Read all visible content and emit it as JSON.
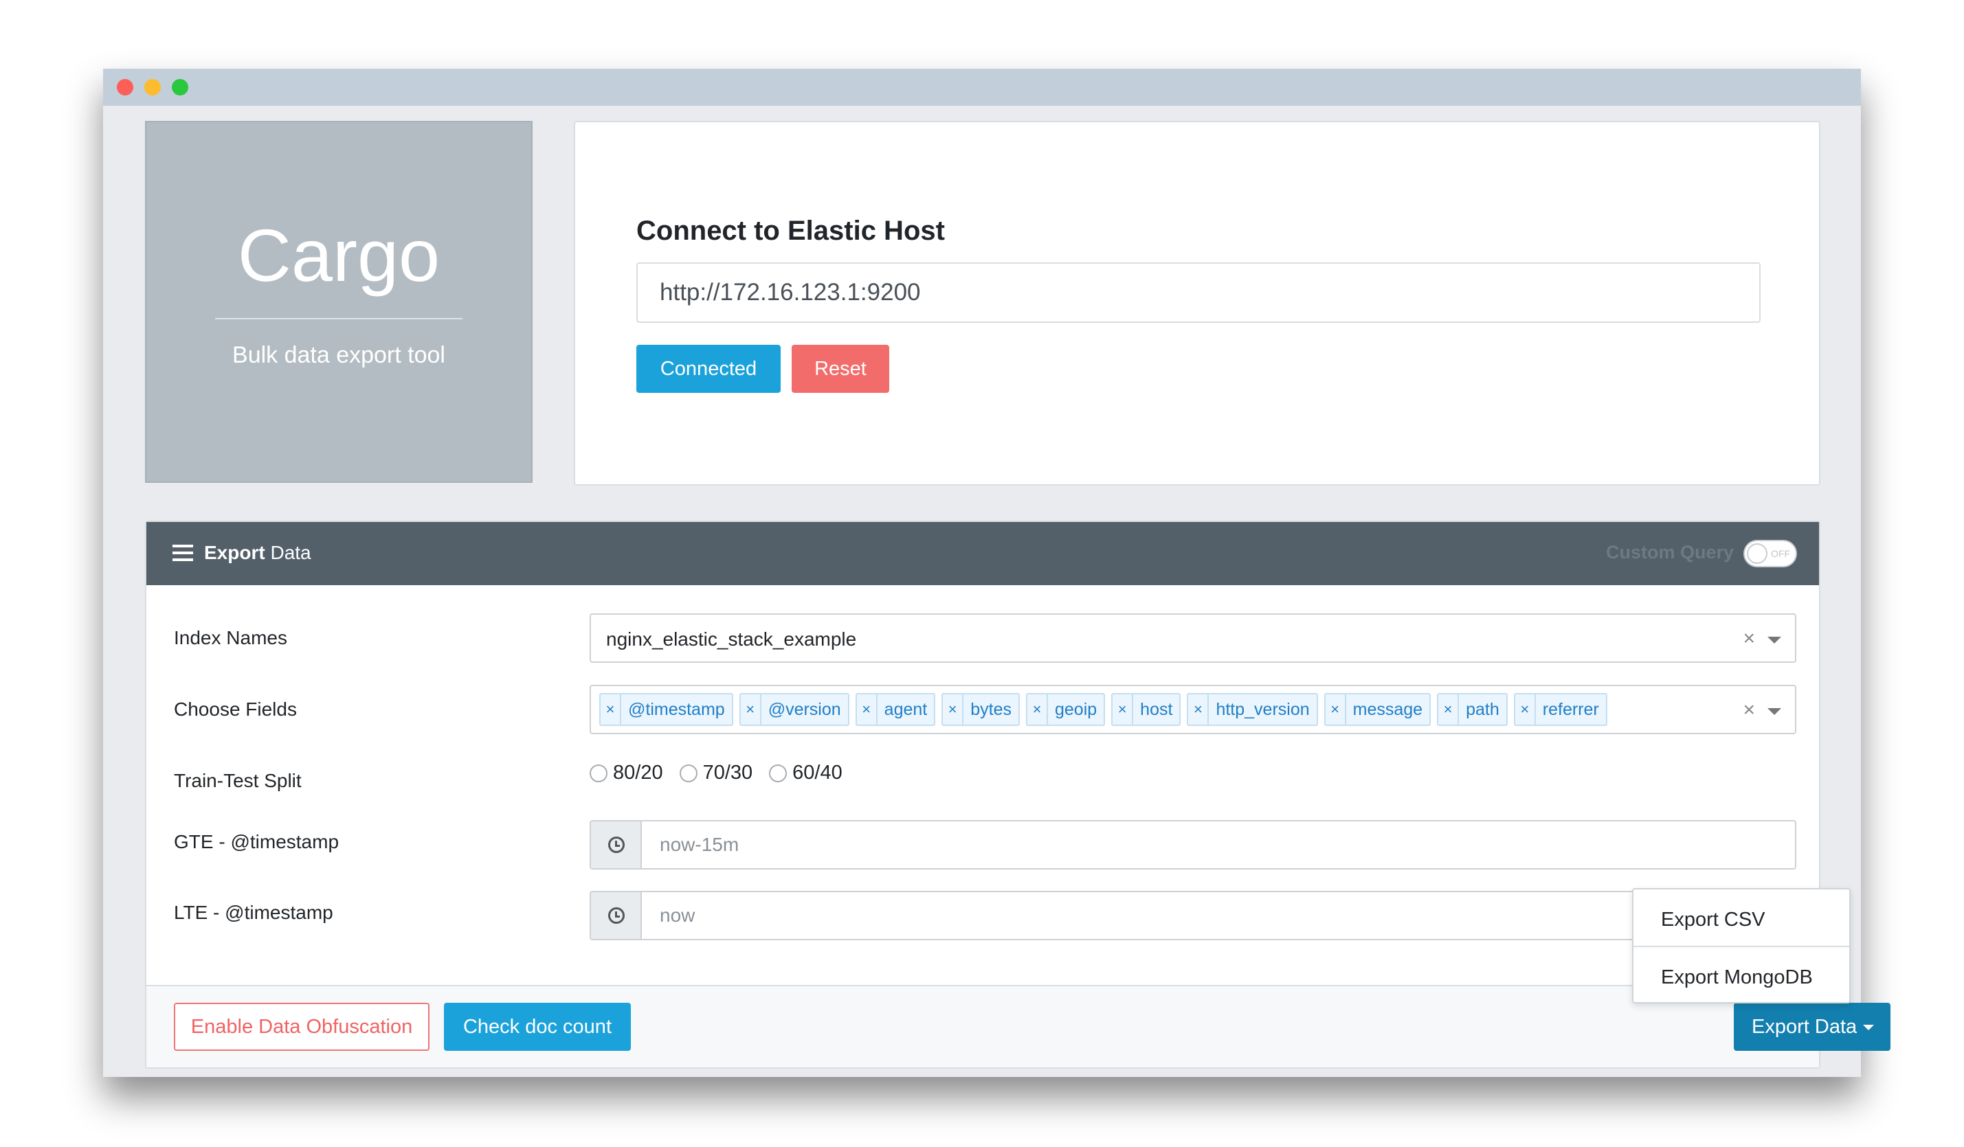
{
  "brand": {
    "title": "Cargo",
    "subtitle": "Bulk data export tool"
  },
  "connect": {
    "title": "Connect to Elastic Host",
    "host_value": "http://172.16.123.1:9200",
    "connected_label": "Connected",
    "reset_label": "Reset"
  },
  "export_panel": {
    "title_bold": "Export",
    "title_rest": " Data",
    "custom_query_label": "Custom Query",
    "toggle_state": "OFF"
  },
  "form": {
    "index_label": "Index Names",
    "index_value": "nginx_elastic_stack_example",
    "fields_label": "Choose Fields",
    "fields": [
      "@timestamp",
      "@version",
      "agent",
      "bytes",
      "geoip",
      "host",
      "http_version",
      "message",
      "path",
      "referrer"
    ],
    "split_label": "Train-Test Split",
    "splits": [
      "80/20",
      "70/30",
      "60/40"
    ],
    "gte_label": "GTE - @timestamp",
    "gte_placeholder": "now-15m",
    "lte_label": "LTE - @timestamp",
    "lte_placeholder": "now",
    "tag_remove_glyph": "×",
    "clear_glyph": "×"
  },
  "footer": {
    "obfuscation_label": "Enable Data Obfuscation",
    "check_label": "Check doc count",
    "export_label": "Export Data"
  },
  "export_menu": {
    "items": [
      "Export CSV",
      "Export MongoDB"
    ]
  }
}
